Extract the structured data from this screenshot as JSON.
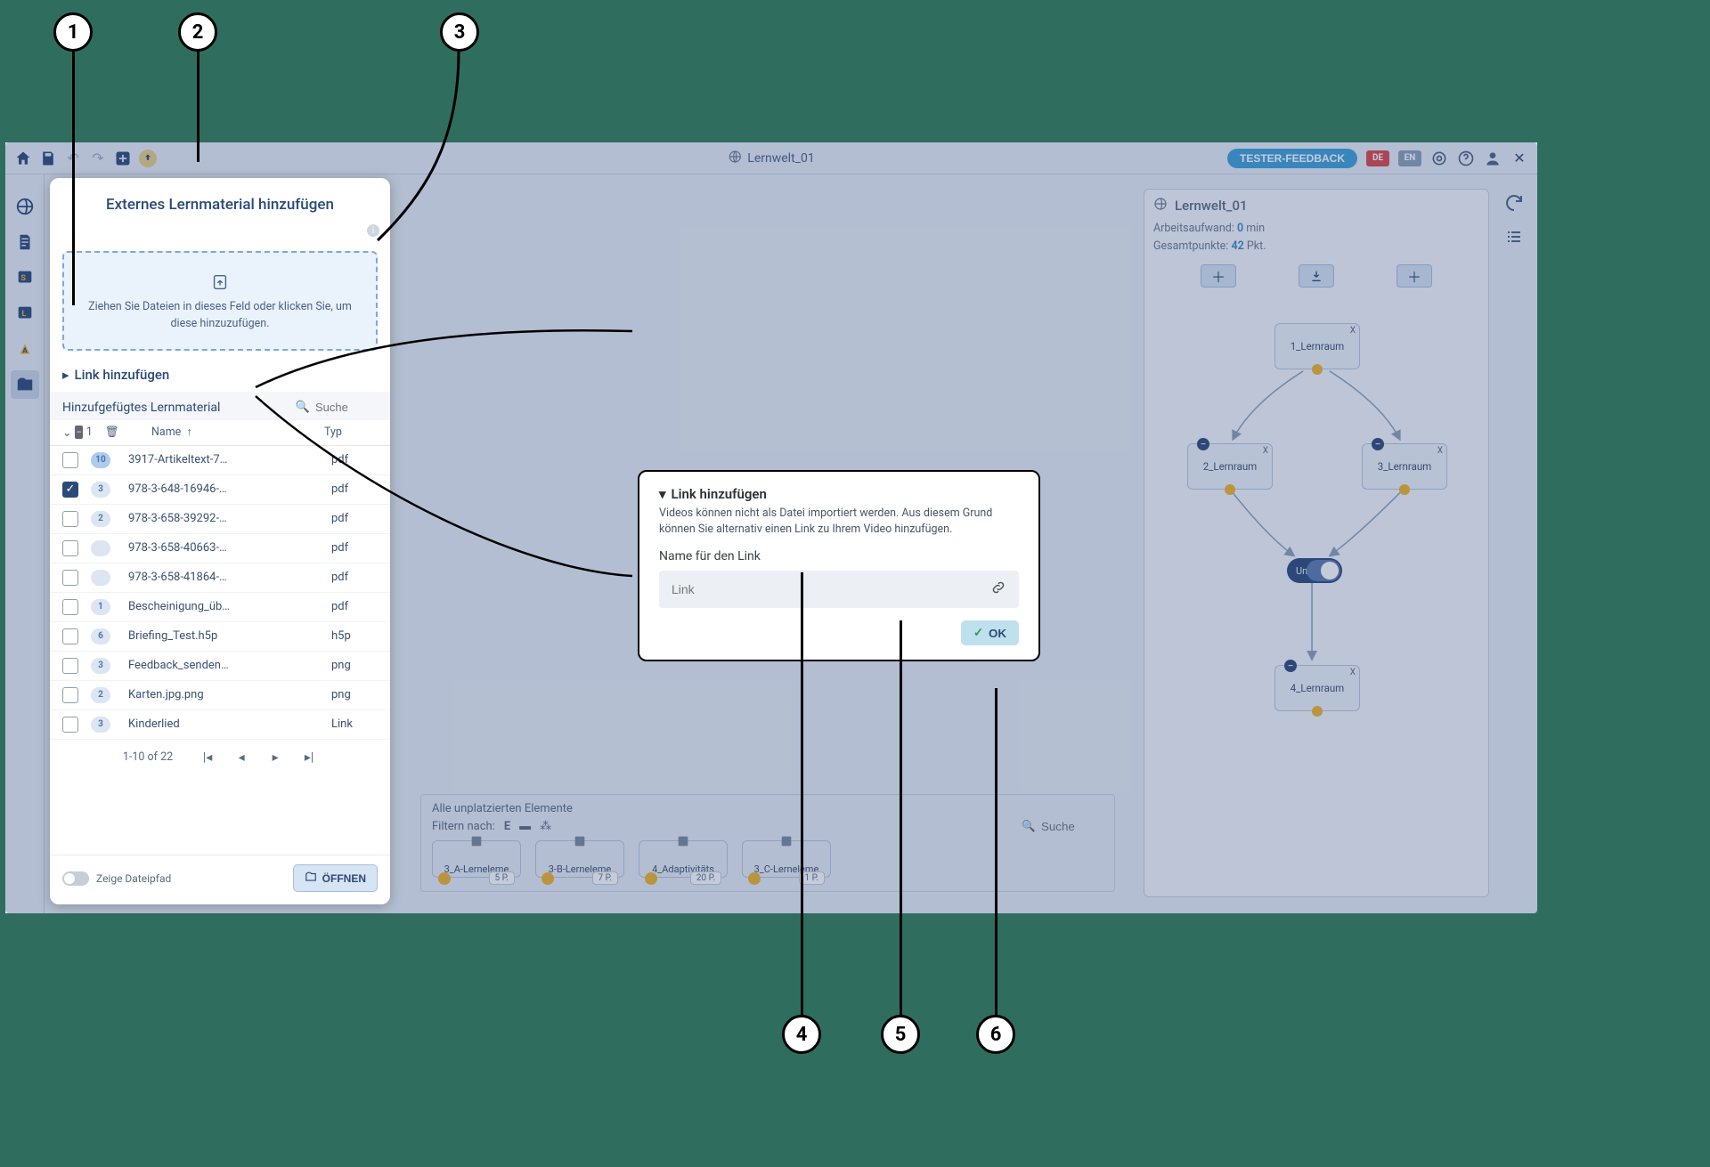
{
  "header": {
    "world_title": "Lernwelt_01",
    "feedback": "TESTER-FEEDBACK",
    "lang_de": "DE",
    "lang_en": "EN"
  },
  "left_panel": {
    "title": "Externes Lernmaterial hinzufügen",
    "dropzone": "Ziehen Sie Dateien in dieses Feld oder klicken Sie, um diese hinzuzufügen.",
    "link_section": "Link hinzufügen",
    "added_header": "Hinzufgefügtes Lernmaterial",
    "search_placeholder": "Suche",
    "col_name": "Name",
    "col_type": "Typ",
    "header_count": "1",
    "rows": [
      {
        "checked": false,
        "badge": "10",
        "badge_strong": true,
        "name": "3917-Artikeltext-7…",
        "type": "pdf"
      },
      {
        "checked": true,
        "badge": "3",
        "name": "978-3-648-16946-…",
        "type": "pdf"
      },
      {
        "checked": false,
        "badge": "2",
        "name": "978-3-658-39292-…",
        "type": "pdf"
      },
      {
        "checked": false,
        "badge": "",
        "name": "978-3-658-40663-…",
        "type": "pdf"
      },
      {
        "checked": false,
        "badge": "",
        "name": "978-3-658-41864-…",
        "type": "pdf"
      },
      {
        "checked": false,
        "badge": "1",
        "name": "Bescheinigung_üb…",
        "type": "pdf"
      },
      {
        "checked": false,
        "badge": "6",
        "name": "Briefing_Test.h5p",
        "type": "h5p"
      },
      {
        "checked": false,
        "badge": "3",
        "name": "Feedback_senden…",
        "type": "png"
      },
      {
        "checked": false,
        "badge": "2",
        "name": "Karten.jpg.png",
        "type": "png"
      },
      {
        "checked": false,
        "badge": "3",
        "name": "Kinderlied",
        "type": "Link"
      }
    ],
    "pagination_label": "1-10 of 22",
    "show_path": "Zeige Dateipfad",
    "open_btn": "ÖFFNEN"
  },
  "link_popover": {
    "title": "Link hinzufügen",
    "desc": "Videos können nicht als Datei importiert werden. Aus diesem Grund können Sie alternativ einen Link zu Ihrem Video hinzufügen.",
    "name_label": "Name für den Link",
    "link_placeholder": "Link",
    "ok": "OK"
  },
  "right_panel": {
    "title": "Lernwelt_01",
    "effort_label": "Arbeitsaufwand:",
    "effort_value": "0",
    "effort_unit": "min",
    "total_label": "Gesamtpunkte:",
    "total_value": "42",
    "total_unit": "Pkt.",
    "nodes": {
      "n1": "1_Lernraum",
      "n2": "2_Lernraum",
      "n3": "3_Lernraum",
      "n4": "4_Lernraum",
      "op": "Und"
    }
  },
  "bottom": {
    "title": "Alle unplatzierten Elemente",
    "filter_label": "Filtern nach:",
    "search_placeholder": "Suche",
    "cards": [
      {
        "label": "3_A-Lerneleme",
        "pts": "5 P."
      },
      {
        "label": "3-B-Lerneleme",
        "pts": "7 P."
      },
      {
        "label": "4_Adaptivitäts",
        "pts": "20 P."
      },
      {
        "label": "3_C-Lerneleme",
        "pts": "1 P."
      }
    ]
  },
  "callouts": [
    "1",
    "2",
    "3",
    "4",
    "5",
    "6"
  ]
}
